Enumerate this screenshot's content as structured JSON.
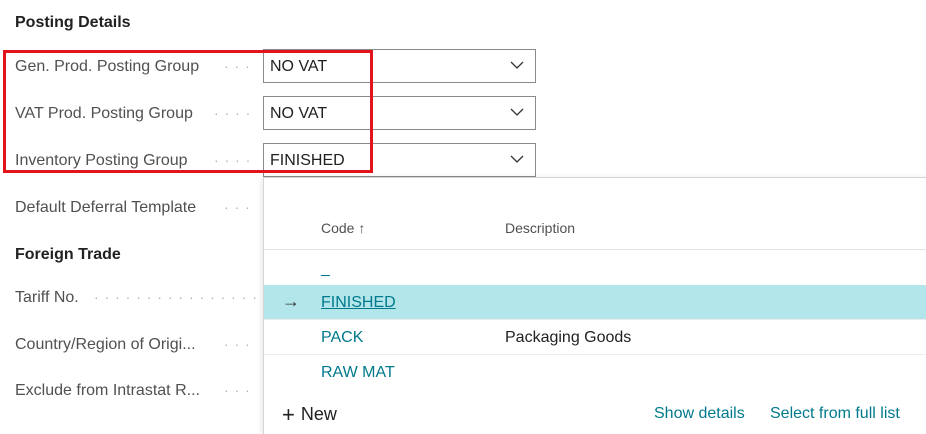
{
  "posting_details": {
    "title": "Posting Details",
    "fields": [
      {
        "label": "Gen. Prod. Posting Group",
        "value": "NO VAT"
      },
      {
        "label": "VAT Prod. Posting Group",
        "value": "NO VAT"
      },
      {
        "label": "Inventory Posting Group",
        "value": "FINISHED"
      },
      {
        "label": "Default Deferral Template",
        "value": ""
      }
    ]
  },
  "foreign_trade": {
    "title": "Foreign Trade",
    "fields": [
      {
        "label": "Tariff No."
      },
      {
        "label": "Country/Region of Origi..."
      },
      {
        "label": "Exclude from Intrastat R..."
      }
    ]
  },
  "dropdown": {
    "col_code": "Code",
    "sort_icon": "↑",
    "col_description": "Description",
    "rows": [
      {
        "code": "_",
        "description": ""
      },
      {
        "code": "FINISHED",
        "description": "",
        "selected": true
      },
      {
        "code": "PACK",
        "description": "Packaging Goods"
      },
      {
        "code": "RAW MAT",
        "description": ""
      }
    ],
    "new_label": "New",
    "show_details": "Show details",
    "select_full_list": "Select from full list"
  },
  "colors": {
    "accent": "#00798c",
    "selected_row": "#b2e6ea",
    "highlight": "#e3121b"
  }
}
